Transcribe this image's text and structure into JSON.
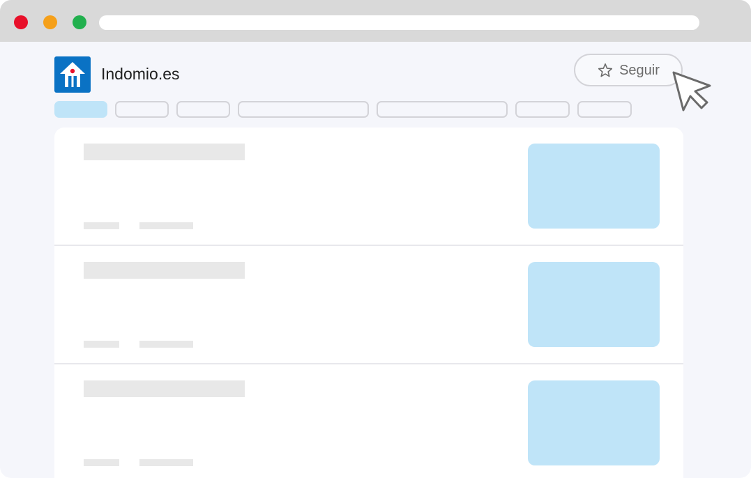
{
  "window": {
    "traffic_lights": {
      "close": "#e8102a",
      "minimize": "#f5a01a",
      "maximize": "#22b04e"
    }
  },
  "site": {
    "name": "Indomio.es",
    "logo_icon": "house-icon",
    "brand_color": "#0a72c4",
    "accent_dot_color": "#e8102a"
  },
  "follow_button": {
    "label": "Seguir",
    "icon": "star-icon"
  },
  "cursor_icon": "pointer-cursor-icon",
  "tabs": [
    {
      "state": "active"
    },
    {
      "state": "inactive"
    },
    {
      "state": "inactive"
    },
    {
      "state": "inactive"
    },
    {
      "state": "inactive"
    },
    {
      "state": "inactive"
    },
    {
      "state": "inactive"
    }
  ],
  "listings": [
    {
      "placeholder": true
    },
    {
      "placeholder": true
    },
    {
      "placeholder": true
    }
  ],
  "colors": {
    "placeholder_gray": "#e8e8e8",
    "placeholder_blue": "#bfe4f8",
    "page_background": "#f5f6fb"
  }
}
